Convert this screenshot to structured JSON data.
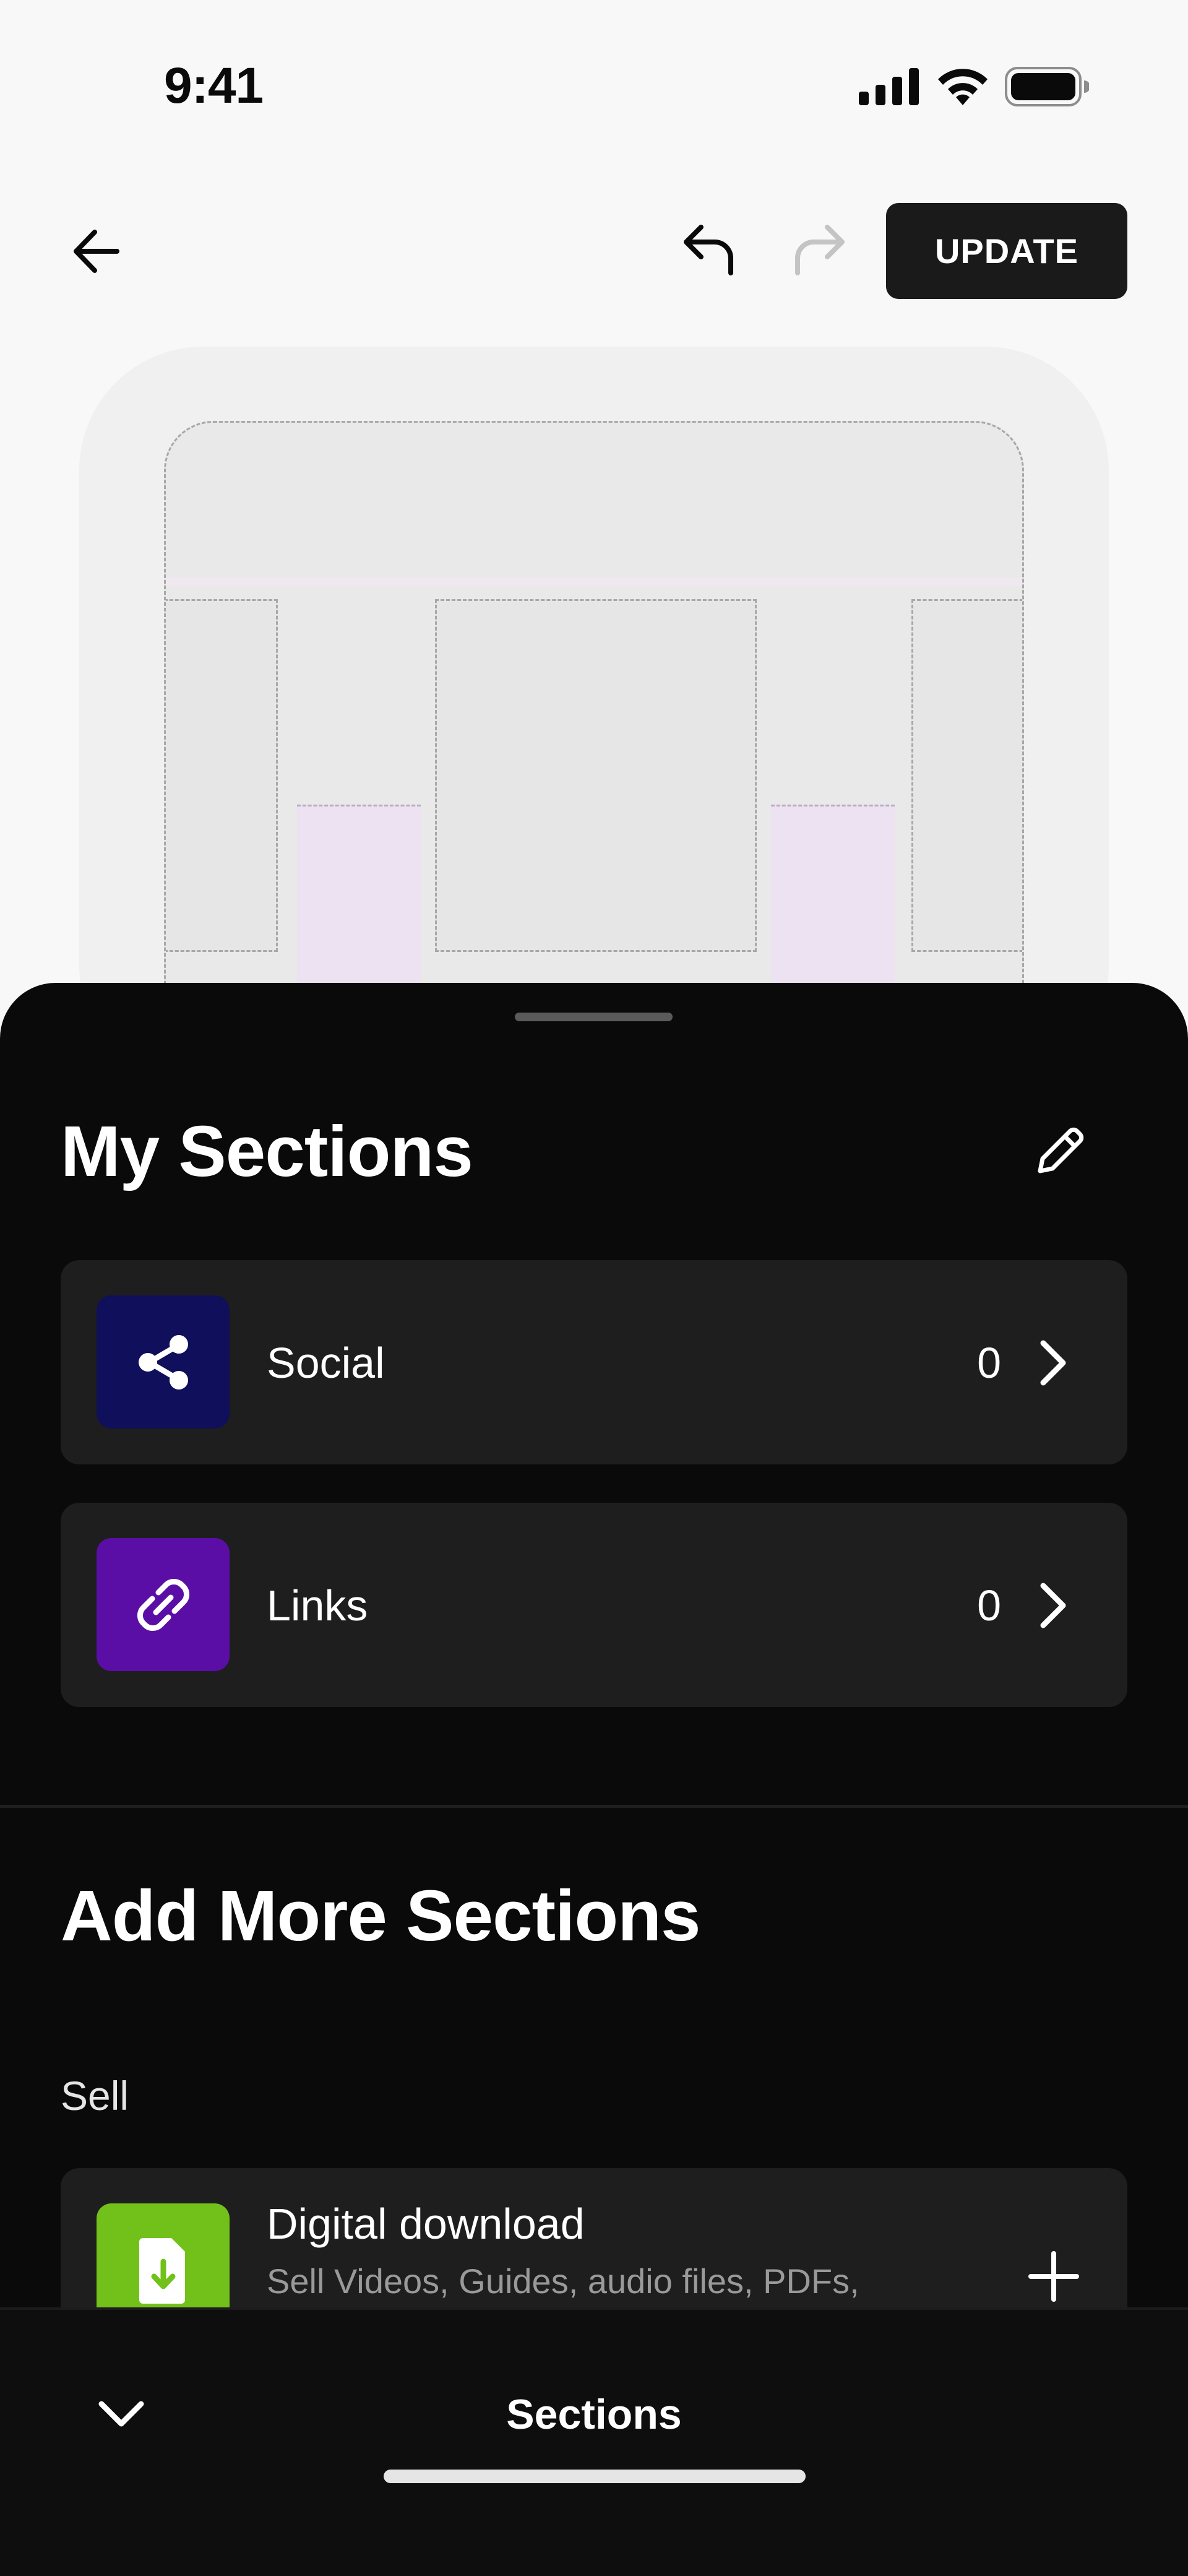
{
  "status_bar": {
    "time": "9:41",
    "icons": [
      "cellular-signal-icon",
      "wifi-icon",
      "battery-icon"
    ]
  },
  "toolbar": {
    "back_icon": "arrow-left-icon",
    "undo_icon": "undo-icon",
    "redo_icon": "redo-icon",
    "redo_enabled": false,
    "update_label": "UPDATE"
  },
  "sheet": {
    "title": "My Sections",
    "edit_icon": "pencil-icon",
    "sections": [
      {
        "label": "Social",
        "count": "0",
        "icon": "share-icon",
        "icon_bg": "#0f0f5c"
      },
      {
        "label": "Links",
        "count": "0",
        "icon": "link-icon",
        "icon_bg": "#5b0ea6"
      }
    ],
    "add_title": "Add More Sections",
    "group_label": "Sell",
    "add_items": [
      {
        "title": "Digital download",
        "subtitle": "Sell Videos, Guides, audio files, PDFs,",
        "icon": "download-file-icon",
        "icon_bg": "#72c11b"
      }
    ]
  },
  "bottom_bar": {
    "collapse_icon": "chevron-down-icon",
    "title": "Sections"
  },
  "colors": {
    "sheet_bg": "#0a0a0a",
    "row_bg": "#1e1e1e",
    "update_bg": "#1a1a1a"
  }
}
